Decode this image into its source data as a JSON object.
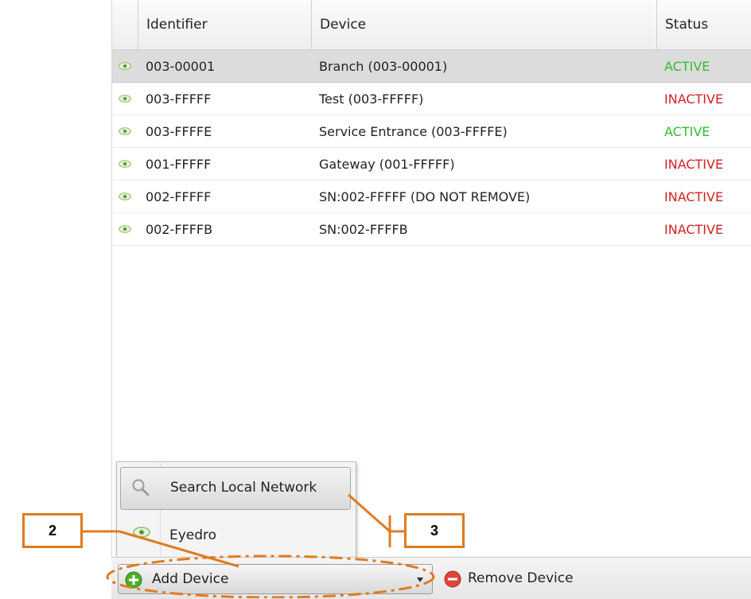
{
  "grid": {
    "columns": [
      "Identifier",
      "Device",
      "Status"
    ],
    "rows": [
      {
        "identifier": "003-00001",
        "device": "Branch (003-00001)",
        "status": "ACTIVE"
      },
      {
        "identifier": "003-FFFFF",
        "device": "Test (003-FFFFF)",
        "status": "INACTIVE"
      },
      {
        "identifier": "003-FFFFE",
        "device": "Service Entrance (003-FFFFE)",
        "status": "ACTIVE"
      },
      {
        "identifier": "001-FFFFF",
        "device": "Gateway (001-FFFFF)",
        "status": "INACTIVE"
      },
      {
        "identifier": "002-FFFFF",
        "device": "SN:002-FFFFF (DO NOT REMOVE)",
        "status": "INACTIVE"
      },
      {
        "identifier": "002-FFFFB",
        "device": "SN:002-FFFFB",
        "status": "INACTIVE"
      }
    ],
    "selected_row": 0
  },
  "menu": {
    "search_label": "Search Local Network",
    "eyedro_label": "Eyedro"
  },
  "toolbar": {
    "add_label": "Add Device",
    "remove_label": "Remove Device"
  },
  "callouts": {
    "left": "2",
    "right": "3"
  },
  "colors": {
    "active": "#2fbf2f",
    "inactive": "#d42020",
    "annotation": "#e07b20",
    "add_icon": "#4caf2a",
    "remove_icon": "#e0453a"
  },
  "icons": {
    "row_icon": "eye-icon",
    "search_icon": "magnifier-icon",
    "eyedro_icon": "eye-icon",
    "add_icon": "plus-circle-icon",
    "dropdown_icon": "chevron-down-icon",
    "remove_icon": "minus-circle-icon"
  }
}
